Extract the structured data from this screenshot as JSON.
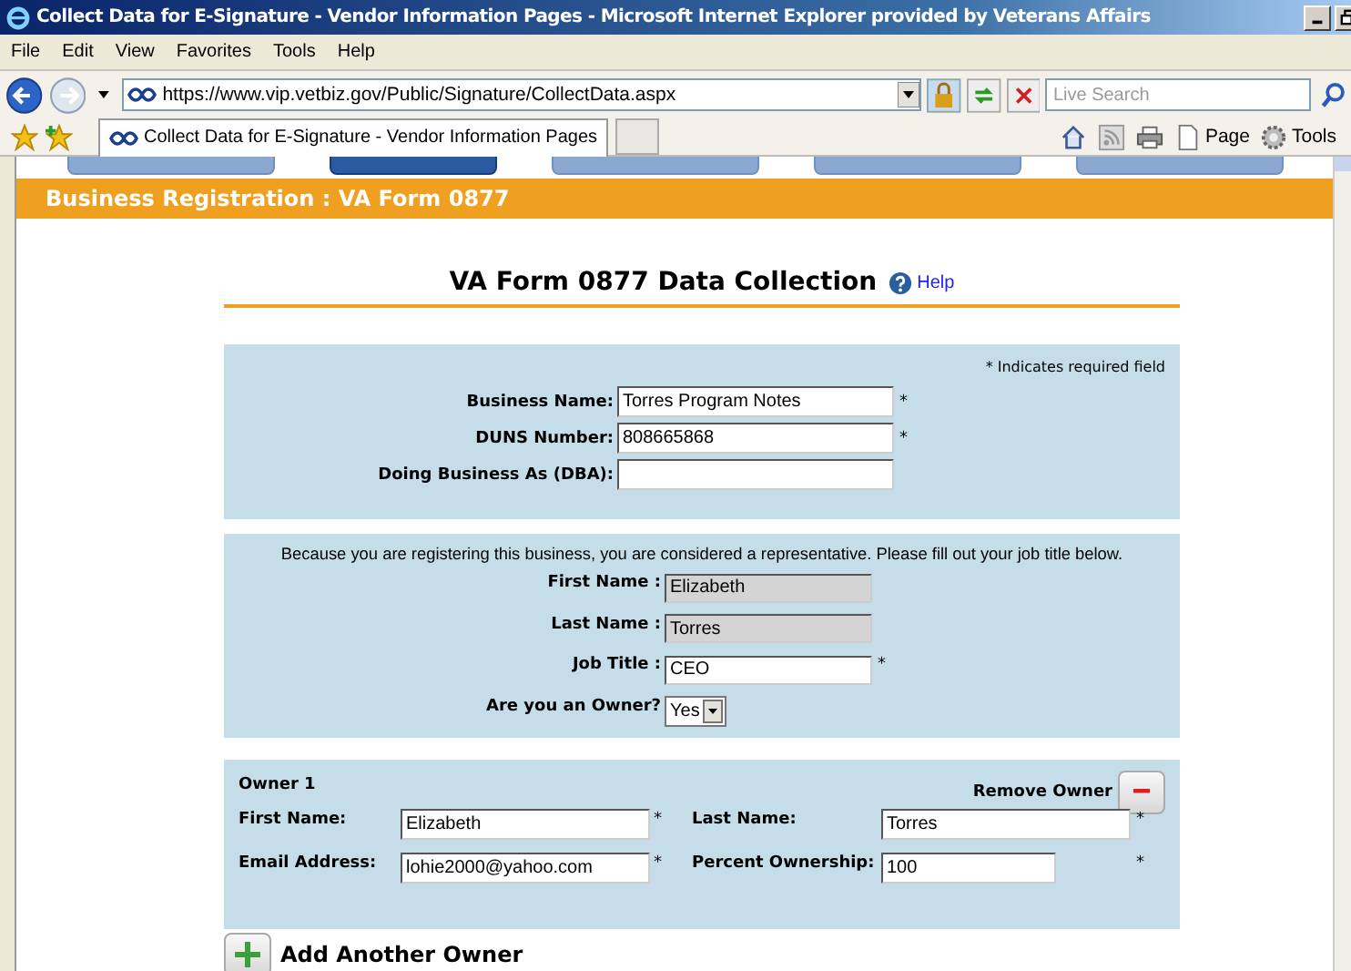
{
  "window": {
    "title": "Collect Data for E-Signature - Vendor Information Pages - Microsoft Internet Explorer provided by Veterans Affairs"
  },
  "menu": [
    "File",
    "Edit",
    "View",
    "Favorites",
    "Tools",
    "Help"
  ],
  "address_bar": {
    "url": "https://www.vip.vetbiz.gov/Public/Signature/CollectData.aspx"
  },
  "search": {
    "placeholder": "Live Search"
  },
  "page_tab": {
    "label": "Collect Data for E-Signature - Vendor Information Pages"
  },
  "toolbar": [
    {
      "label": "Page"
    },
    {
      "label": "Tools"
    }
  ],
  "steps": [
    {
      "selected": false
    },
    {
      "selected": true
    },
    {
      "selected": false
    },
    {
      "selected": false
    },
    {
      "selected": false
    }
  ],
  "banner": "Business Registration : VA Form 0877",
  "heading": "VA Form 0877 Data Collection",
  "help_link": "Help",
  "required_note": "* Indicates required field",
  "business_fields": [
    {
      "label": "Business Name:",
      "value": "Torres Program Notes",
      "mark": "*"
    },
    {
      "label": "DUNS Number:",
      "value": "808665868",
      "mark": "*"
    },
    {
      "label": "Doing Business As (DBA):"
    }
  ],
  "representative": {
    "note": "Because you are registering this business, you are considered a representative. Please fill out your job title below.",
    "fields": [
      {
        "label": "First Name :",
        "value": "Elizabeth",
        "kind": "readonly"
      },
      {
        "label": "Last Name :",
        "value": "Torres",
        "kind": "readonly"
      },
      {
        "label": "Job Title :",
        "value": "CEO",
        "kind": "text",
        "mark": "*"
      },
      {
        "label": "Are you an Owner?",
        "value": "Yes",
        "kind": "select"
      }
    ]
  },
  "owner": {
    "title": "Owner 1",
    "remove_label": "Remove Owner",
    "fields": [
      {
        "label": "First Name:",
        "value": "Elizabeth",
        "mark": "*"
      },
      {
        "label": "Last Name:",
        "value": "Torres",
        "mark": "*"
      },
      {
        "label": "Email Address:",
        "value": "lohie2000@yahoo.com",
        "mark": "*"
      },
      {
        "label": "Percent Ownership:",
        "value": "100",
        "mark": "*",
        "short": true
      }
    ]
  },
  "add_owner_label": "Add Another Owner"
}
